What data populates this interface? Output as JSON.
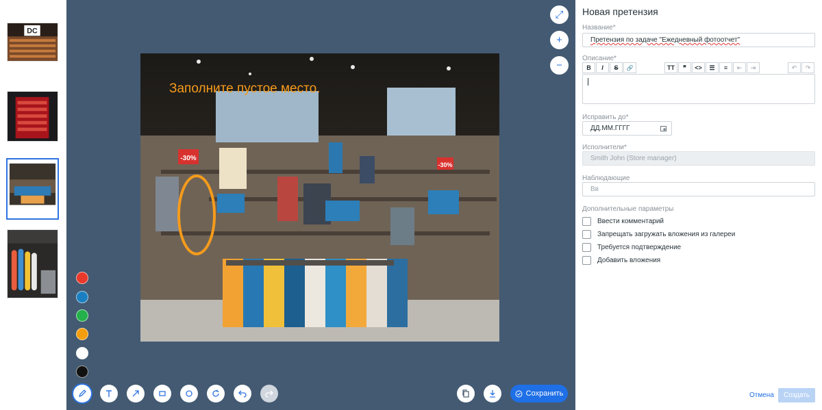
{
  "thumbnails": [
    {
      "name": "DC store wall",
      "active": false
    },
    {
      "name": "red shelves",
      "active": false
    },
    {
      "name": "clothing store",
      "active": true
    },
    {
      "name": "surfboards",
      "active": false
    }
  ],
  "editor": {
    "annotation_text": "Заполните пустое место.",
    "price_tag_left": "-30%",
    "price_tag_right": "-30%",
    "zoom": [
      {
        "icon": "fullscreen-icon",
        "glyph": "⤢"
      },
      {
        "icon": "zoom-in-icon",
        "glyph": "+"
      },
      {
        "icon": "zoom-out-icon",
        "glyph": "−"
      }
    ],
    "colors": [
      "#e8392a",
      "#1a7fc1",
      "#24b04a",
      "#f49d0e",
      "#ffffff",
      "#111111"
    ],
    "tools": [
      {
        "icon": "pencil-icon",
        "active": true,
        "disabled": false
      },
      {
        "icon": "text-icon",
        "active": false,
        "disabled": false
      },
      {
        "icon": "arrow-icon",
        "active": false,
        "disabled": false
      },
      {
        "icon": "rectangle-icon",
        "active": false,
        "disabled": false
      },
      {
        "icon": "circle-icon",
        "active": false,
        "disabled": false
      },
      {
        "icon": "rotate-icon",
        "active": false,
        "disabled": false
      },
      {
        "icon": "undo-icon",
        "active": false,
        "disabled": false
      },
      {
        "icon": "redo-icon",
        "active": false,
        "disabled": true
      }
    ],
    "copy_icon": "copy-icon",
    "download_icon": "download-icon",
    "save_label": "Сохранить"
  },
  "form": {
    "title": "Новая претензия",
    "name_label": "Название*",
    "name_value": "Претензия по задаче \"Ежедневный фотоотчет\"",
    "description_label": "Описание*",
    "toolbar": {
      "bold": "B",
      "italic": "I",
      "strike": "S",
      "link": "🔗",
      "heading": "TT",
      "quote": "❞",
      "code": "<>",
      "bullets": "☰",
      "numbers": "≡",
      "outdent": "⇤",
      "indent": "⇥",
      "undo": "↶",
      "redo": "↷"
    },
    "due_label": "Исправить до*",
    "due_placeholder": "ДД.ММ.ГГГГ",
    "executors_label": "Исполнители*",
    "executors_value": "Smith John (Store manager)",
    "observers_label": "Наблюдающие",
    "observers_placeholder": "Вв",
    "extra_label": "Дополнительные параметры",
    "options": [
      {
        "label": "Ввести комментарий",
        "checked": false
      },
      {
        "label": "Запрещать загружать вложения из галереи",
        "checked": false
      },
      {
        "label": "Требуется подтверждение",
        "checked": false
      },
      {
        "label": "Добавить вложения",
        "checked": false
      }
    ],
    "cancel_label": "Отмена",
    "create_label": "Создать"
  }
}
